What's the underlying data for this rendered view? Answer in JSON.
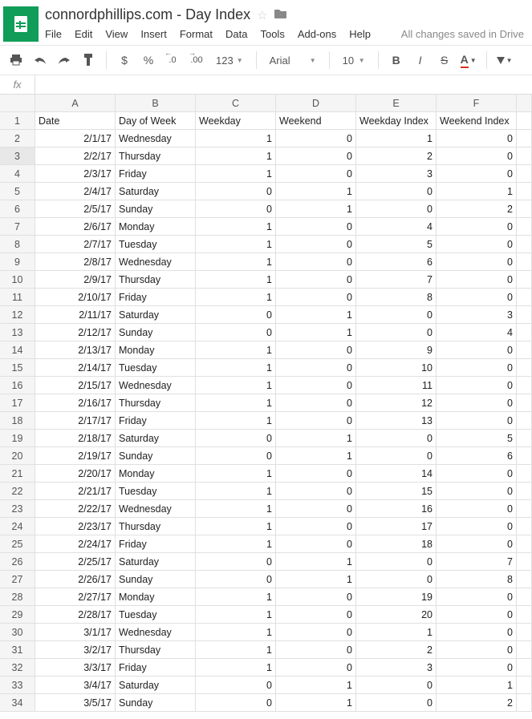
{
  "doc": {
    "title": "connordphillips.com - Day Index"
  },
  "menu": {
    "file": "File",
    "edit": "Edit",
    "view": "View",
    "insert": "Insert",
    "format": "Format",
    "data": "Data",
    "tools": "Tools",
    "addons": "Add-ons",
    "help": "Help",
    "save_status": "All changes saved in Drive"
  },
  "toolbar": {
    "dollar": "$",
    "percent": "%",
    "dec_dec": ".0",
    "dec_inc": ".00",
    "numfmt": "123",
    "font": "Arial",
    "fontsize": "10",
    "bold": "B",
    "italic": "I",
    "strike": "S",
    "textcolor": "A"
  },
  "formula": {
    "fx_label": "fx",
    "value": ""
  },
  "columns": [
    "A",
    "B",
    "C",
    "D",
    "E",
    "F"
  ],
  "headers": [
    "Date",
    "Day of Week",
    "Weekday",
    "Weekend",
    "Weekday Index",
    "Weekend Index"
  ],
  "selected_row": 3,
  "rows": [
    {
      "n": 1,
      "header": true
    },
    {
      "n": 2,
      "c": [
        "2/1/17",
        "Wednesday",
        "1",
        "0",
        "1",
        "0"
      ]
    },
    {
      "n": 3,
      "c": [
        "2/2/17",
        "Thursday",
        "1",
        "0",
        "2",
        "0"
      ]
    },
    {
      "n": 4,
      "c": [
        "2/3/17",
        "Friday",
        "1",
        "0",
        "3",
        "0"
      ]
    },
    {
      "n": 5,
      "c": [
        "2/4/17",
        "Saturday",
        "0",
        "1",
        "0",
        "1"
      ]
    },
    {
      "n": 6,
      "c": [
        "2/5/17",
        "Sunday",
        "0",
        "1",
        "0",
        "2"
      ]
    },
    {
      "n": 7,
      "c": [
        "2/6/17",
        "Monday",
        "1",
        "0",
        "4",
        "0"
      ]
    },
    {
      "n": 8,
      "c": [
        "2/7/17",
        "Tuesday",
        "1",
        "0",
        "5",
        "0"
      ]
    },
    {
      "n": 9,
      "c": [
        "2/8/17",
        "Wednesday",
        "1",
        "0",
        "6",
        "0"
      ]
    },
    {
      "n": 10,
      "c": [
        "2/9/17",
        "Thursday",
        "1",
        "0",
        "7",
        "0"
      ]
    },
    {
      "n": 11,
      "c": [
        "2/10/17",
        "Friday",
        "1",
        "0",
        "8",
        "0"
      ]
    },
    {
      "n": 12,
      "c": [
        "2/11/17",
        "Saturday",
        "0",
        "1",
        "0",
        "3"
      ]
    },
    {
      "n": 13,
      "c": [
        "2/12/17",
        "Sunday",
        "0",
        "1",
        "0",
        "4"
      ]
    },
    {
      "n": 14,
      "c": [
        "2/13/17",
        "Monday",
        "1",
        "0",
        "9",
        "0"
      ]
    },
    {
      "n": 15,
      "c": [
        "2/14/17",
        "Tuesday",
        "1",
        "0",
        "10",
        "0"
      ]
    },
    {
      "n": 16,
      "c": [
        "2/15/17",
        "Wednesday",
        "1",
        "0",
        "11",
        "0"
      ]
    },
    {
      "n": 17,
      "c": [
        "2/16/17",
        "Thursday",
        "1",
        "0",
        "12",
        "0"
      ]
    },
    {
      "n": 18,
      "c": [
        "2/17/17",
        "Friday",
        "1",
        "0",
        "13",
        "0"
      ]
    },
    {
      "n": 19,
      "c": [
        "2/18/17",
        "Saturday",
        "0",
        "1",
        "0",
        "5"
      ]
    },
    {
      "n": 20,
      "c": [
        "2/19/17",
        "Sunday",
        "0",
        "1",
        "0",
        "6"
      ]
    },
    {
      "n": 21,
      "c": [
        "2/20/17",
        "Monday",
        "1",
        "0",
        "14",
        "0"
      ]
    },
    {
      "n": 22,
      "c": [
        "2/21/17",
        "Tuesday",
        "1",
        "0",
        "15",
        "0"
      ]
    },
    {
      "n": 23,
      "c": [
        "2/22/17",
        "Wednesday",
        "1",
        "0",
        "16",
        "0"
      ]
    },
    {
      "n": 24,
      "c": [
        "2/23/17",
        "Thursday",
        "1",
        "0",
        "17",
        "0"
      ]
    },
    {
      "n": 25,
      "c": [
        "2/24/17",
        "Friday",
        "1",
        "0",
        "18",
        "0"
      ]
    },
    {
      "n": 26,
      "c": [
        "2/25/17",
        "Saturday",
        "0",
        "1",
        "0",
        "7"
      ]
    },
    {
      "n": 27,
      "c": [
        "2/26/17",
        "Sunday",
        "0",
        "1",
        "0",
        "8"
      ]
    },
    {
      "n": 28,
      "c": [
        "2/27/17",
        "Monday",
        "1",
        "0",
        "19",
        "0"
      ]
    },
    {
      "n": 29,
      "c": [
        "2/28/17",
        "Tuesday",
        "1",
        "0",
        "20",
        "0"
      ]
    },
    {
      "n": 30,
      "c": [
        "3/1/17",
        "Wednesday",
        "1",
        "0",
        "1",
        "0"
      ]
    },
    {
      "n": 31,
      "c": [
        "3/2/17",
        "Thursday",
        "1",
        "0",
        "2",
        "0"
      ]
    },
    {
      "n": 32,
      "c": [
        "3/3/17",
        "Friday",
        "1",
        "0",
        "3",
        "0"
      ]
    },
    {
      "n": 33,
      "c": [
        "3/4/17",
        "Saturday",
        "0",
        "1",
        "0",
        "1"
      ]
    },
    {
      "n": 34,
      "c": [
        "3/5/17",
        "Sunday",
        "0",
        "1",
        "0",
        "2"
      ]
    }
  ]
}
